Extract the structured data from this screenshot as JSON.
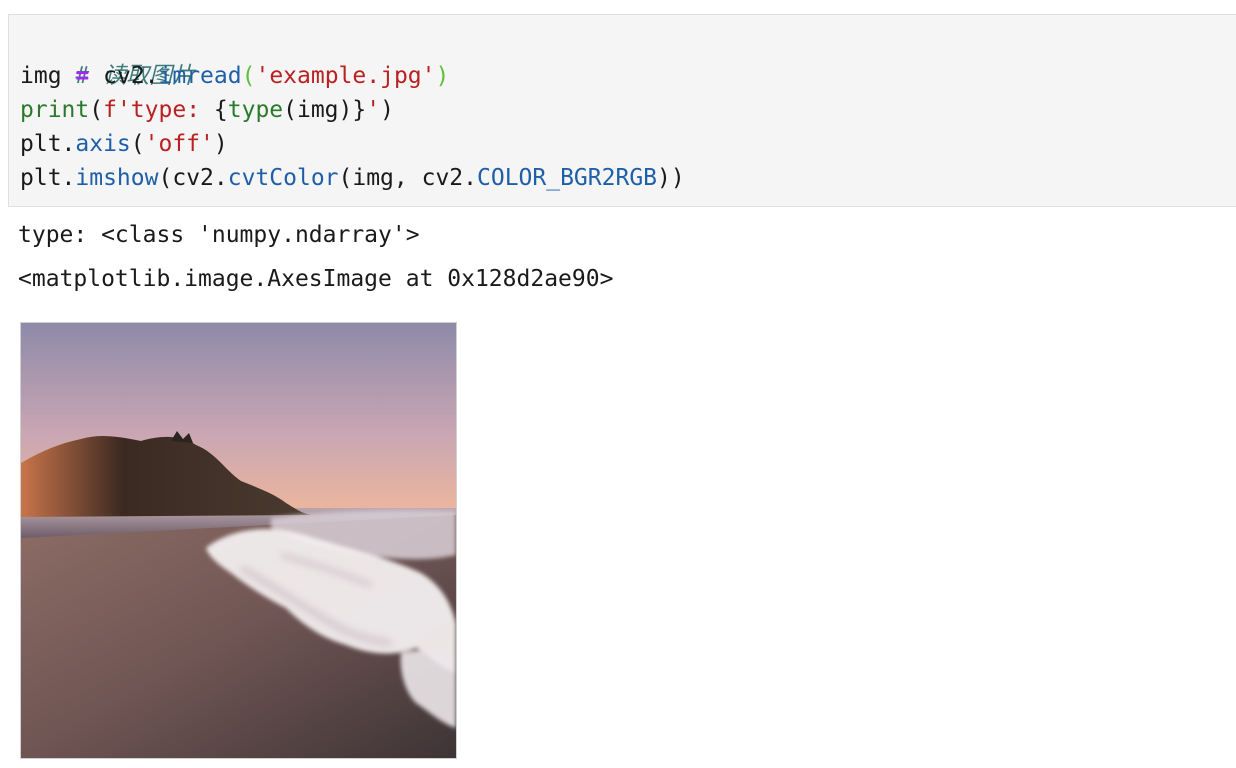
{
  "cell_input": {
    "comment": "# 读取图片",
    "lines": [
      {
        "var": "img",
        "op": "=",
        "obj": "cv2.",
        "func": "imread",
        "open": "(",
        "arg": "'example.jpg'",
        "close": ")"
      },
      {
        "builtin": "print",
        "open": "(",
        "fstr": "f'type: ",
        "brace_open": "{",
        "inner_fn": "type",
        "inner_arg": "(img)",
        "brace_close": "}",
        "fend": "'",
        "close": ")"
      },
      {
        "obj": "plt.",
        "func": "axis",
        "open": "(",
        "arg": "'off'",
        "close": ")"
      },
      {
        "obj": "plt.",
        "func": "imshow",
        "open": "(",
        "arg1": "cv2.",
        "func2": "cvtColor",
        "args2": "(img, cv2.",
        "const": "COLOR_BGR2RGB",
        "close": "))"
      }
    ]
  },
  "cell_output": {
    "stdout": "type: <class 'numpy.ndarray'>",
    "repr": "<matplotlib.image.AxesImage at 0x128d2ae90>"
  },
  "image": {
    "icon": "beach-sunset-image",
    "colors": {
      "sky_top": "#8d8aa8",
      "sky_mid": "#c9a6b3",
      "sky_low": "#f1b89b",
      "cliff_dark": "#3b2a22",
      "cliff_lit": "#c9744a",
      "sand": "#7a5f5c",
      "foam": "#f2eeef"
    }
  }
}
